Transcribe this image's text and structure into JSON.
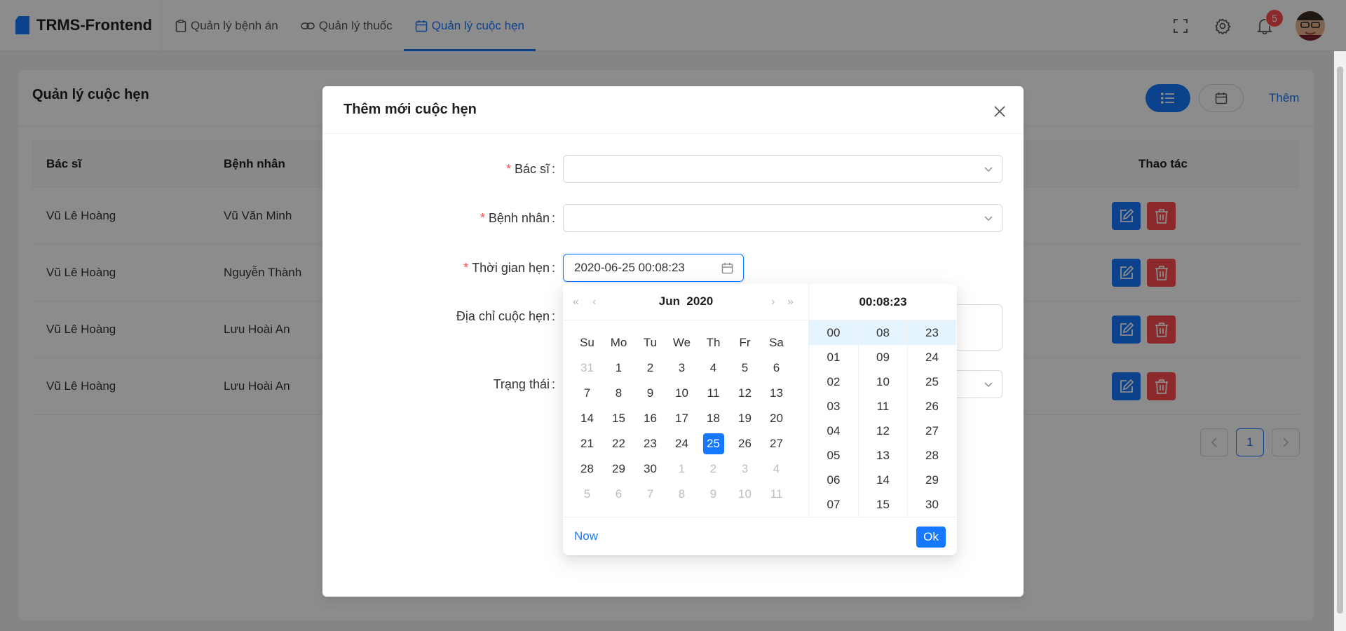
{
  "app": {
    "title": "TRMS-Frontend"
  },
  "nav": [
    {
      "label": "Quản lý bệnh án",
      "icon": "clipboard-icon"
    },
    {
      "label": "Quản lý thuốc",
      "icon": "link-icon"
    },
    {
      "label": "Quản lý cuộc hẹn",
      "icon": "calendar-icon",
      "active": true
    }
  ],
  "header": {
    "notification_count": "5"
  },
  "page": {
    "title": "Quản lý cuộc hẹn",
    "add_label": "Thêm",
    "columns": {
      "doctor": "Bác sĩ",
      "patient": "Bệnh nhân",
      "actions": "Thao tác"
    },
    "rows": [
      {
        "doctor": "Vũ Lê Hoàng",
        "patient": "Vũ Văn Minh"
      },
      {
        "doctor": "Vũ Lê Hoàng",
        "patient": "Nguyễn Thành"
      },
      {
        "doctor": "Vũ Lê Hoàng",
        "patient": "Lưu Hoài An"
      },
      {
        "doctor": "Vũ Lê Hoàng",
        "patient": "Lưu Hoài An"
      }
    ],
    "pagination": {
      "current": "1"
    }
  },
  "modal": {
    "title": "Thêm mới cuộc hẹn",
    "fields": {
      "doctor_label": "Bác sĩ",
      "patient_label": "Bệnh nhân",
      "time_label": "Thời gian hẹn",
      "time_value": "2020-06-25 00:08:23",
      "address_label": "Địa chỉ cuộc hẹn",
      "status_label": "Trạng thái"
    }
  },
  "picker": {
    "month": "Jun",
    "year": "2020",
    "time_display": "00:08:23",
    "weekdays": [
      "Su",
      "Mo",
      "Tu",
      "We",
      "Th",
      "Fr",
      "Sa"
    ],
    "weeks": [
      [
        "31",
        "1",
        "2",
        "3",
        "4",
        "5",
        "6"
      ],
      [
        "7",
        "8",
        "9",
        "10",
        "11",
        "12",
        "13"
      ],
      [
        "14",
        "15",
        "16",
        "17",
        "18",
        "19",
        "20"
      ],
      [
        "21",
        "22",
        "23",
        "24",
        "25",
        "26",
        "27"
      ],
      [
        "28",
        "29",
        "30",
        "1",
        "2",
        "3",
        "4"
      ],
      [
        "5",
        "6",
        "7",
        "8",
        "9",
        "10",
        "11"
      ]
    ],
    "selected_day": "25",
    "hours": [
      "00",
      "01",
      "02",
      "03",
      "04",
      "05",
      "06",
      "07"
    ],
    "minutes": [
      "08",
      "09",
      "10",
      "11",
      "12",
      "13",
      "14",
      "15"
    ],
    "seconds": [
      "23",
      "24",
      "25",
      "26",
      "27",
      "28",
      "29",
      "30"
    ],
    "now_label": "Now",
    "ok_label": "Ok"
  },
  "colors": {
    "primary": "#1677ff",
    "danger": "#ff4d4f"
  }
}
